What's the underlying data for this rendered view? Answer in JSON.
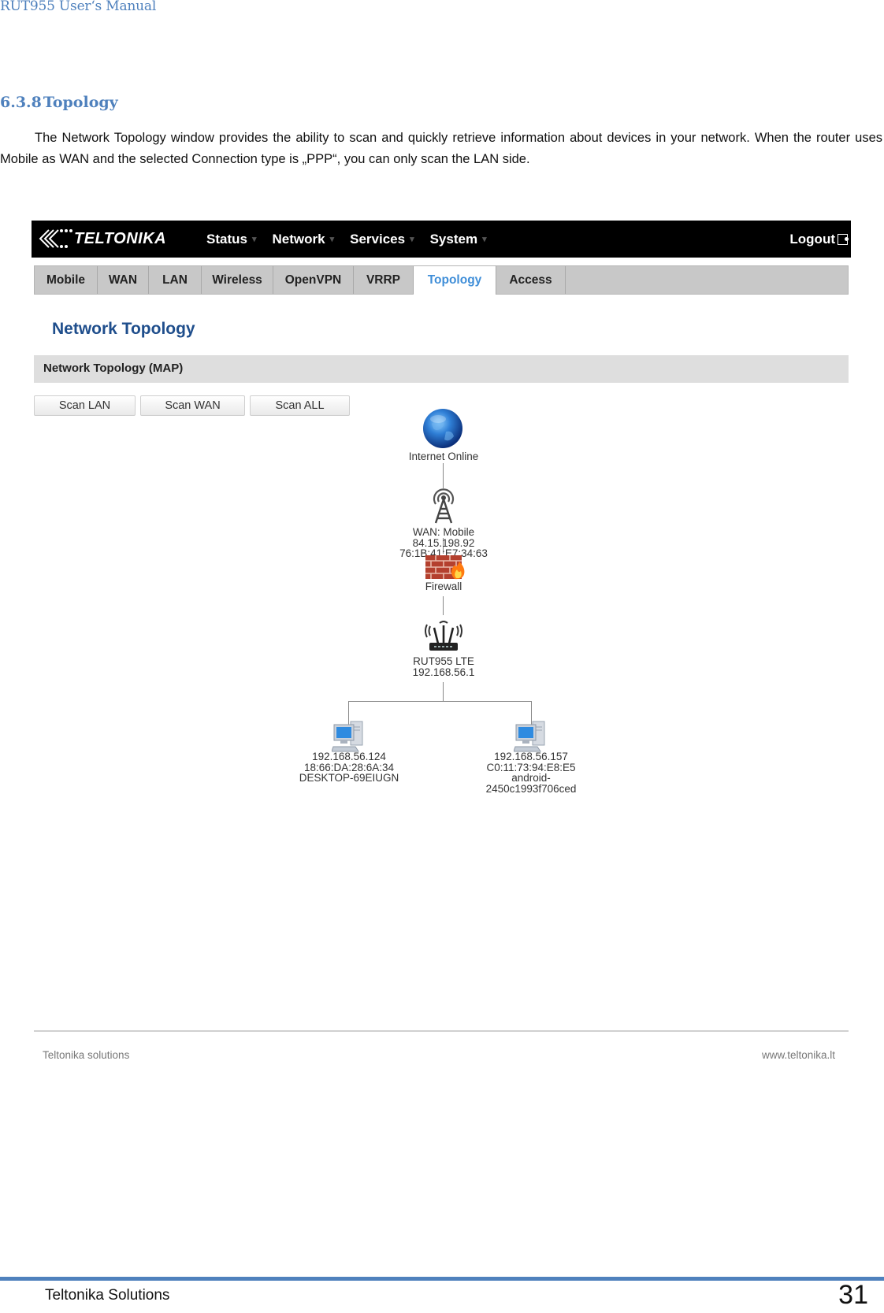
{
  "document": {
    "header": "RUT955 User‘s Manual",
    "section_number": "6.3.8",
    "section_title": "Topology",
    "paragraph": "The Network Topology window provides the ability to scan and quickly retrieve information about devices in your network. When the router uses Mobile as WAN and the selected Connection type is „PPP“, you can only scan the LAN side.",
    "footer_company": "Teltonika Solutions",
    "page_number": "31"
  },
  "screenshot": {
    "brand": "TELTONIKA",
    "menu": [
      {
        "label": "Status",
        "icon": "caret-down-icon"
      },
      {
        "label": "Network",
        "icon": "caret-down-icon"
      },
      {
        "label": "Services",
        "icon": "caret-down-icon"
      },
      {
        "label": "System",
        "icon": "caret-down-icon"
      }
    ],
    "logout_label": "Logout",
    "tabs": [
      {
        "label": "Mobile",
        "active": false
      },
      {
        "label": "WAN",
        "active": false
      },
      {
        "label": "LAN",
        "active": false
      },
      {
        "label": "Wireless",
        "active": false
      },
      {
        "label": "OpenVPN",
        "active": false
      },
      {
        "label": "VRRP",
        "active": false
      },
      {
        "label": "Topology",
        "active": true
      },
      {
        "label": "Access",
        "active": false
      }
    ],
    "page_title": "Network Topology",
    "panel_title": "Network Topology (MAP)",
    "buttons": {
      "scan_lan": "Scan LAN",
      "scan_wan": "Scan WAN",
      "scan_all": "Scan ALL"
    },
    "topology": {
      "internet": {
        "icon": "globe-icon",
        "lines": [
          "Internet Online"
        ]
      },
      "wan": {
        "icon": "antenna-icon",
        "lines": [
          "WAN: Mobile",
          "84.15.198.92",
          "76:1B:41:E7:34:63"
        ]
      },
      "firewall": {
        "icon": "firewall-icon",
        "lines": [
          "Firewall"
        ]
      },
      "router": {
        "icon": "router-icon",
        "lines": [
          "RUT955 LTE",
          "192.168.56.1"
        ]
      },
      "clients": [
        {
          "icon": "computer-icon",
          "lines": [
            "192.168.56.124",
            "18:66:DA:28:6A:34",
            "DESKTOP-69EIUGN"
          ]
        },
        {
          "icon": "computer-icon",
          "lines": [
            "192.168.56.157",
            "C0:11:73:94:E8:E5",
            "android-",
            "2450c1993f706ced"
          ]
        }
      ]
    },
    "footer_left": "Teltonika solutions",
    "footer_right": "www.teltonika.lt"
  }
}
